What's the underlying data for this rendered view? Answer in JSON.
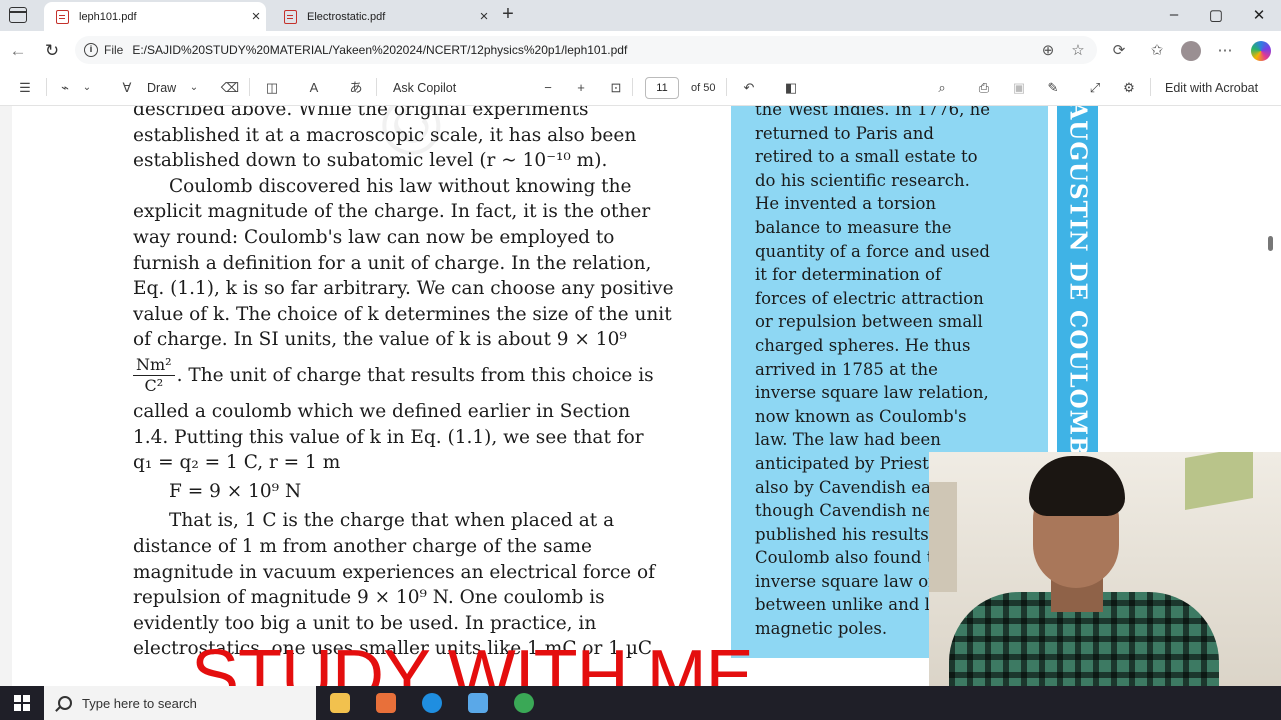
{
  "browser": {
    "tabs": [
      {
        "label": "leph101.pdf",
        "icon": "pdf-icon",
        "active": true
      },
      {
        "label": "Electrostatic.pdf",
        "icon": "pdf-icon",
        "active": false
      }
    ],
    "address": {
      "scheme_label": "File",
      "url": "E:/SAJID%20STUDY%20MATERIAL/Yakeen%202024/NCERT/12physics%20p1/leph101.pdf"
    }
  },
  "pdf_toolbar": {
    "draw_label": "Draw",
    "ask_copilot_label": "Ask Copilot",
    "page_current": "11",
    "page_total": "of 50",
    "edit_acrobat_label": "Edit with Acrobat"
  },
  "document": {
    "main_lines": [
      "described above. While the original experiments",
      "established it at a macroscopic scale, it has also been",
      "established down to subatomic level  (r ~ 10⁻¹⁰ m).",
      "Coulomb discovered his law without knowing the",
      "explicit magnitude of the charge. In fact, it is the other",
      "way round: Coulomb's law can now be employed to",
      "furnish a definition for a unit of charge. In the relation,",
      "Eq. (1.1), k is so far arbitrary. We can choose any positive",
      "value of k. The choice of k determines the size of the unit",
      "of charge. In SI units, the value of k is about 9 × 10⁹",
      ". The unit of charge that results from this choice is",
      "called a coulomb which we defined earlier in Section",
      "1.4. Putting this value of k in Eq. (1.1), we see that for",
      "q₁ = q₂ = 1 C, r = 1 m",
      "F = 9 × 10⁹ N",
      "That is, 1 C is the charge that when placed at a",
      "distance of 1 m from another charge of the same",
      "magnitude in vacuum experiences an electrical force of",
      "repulsion of magnitude 9 × 10⁹ N. One coulomb is",
      "evidently too big a unit to be used. In practice, in",
      "electrostatics, one uses smaller units like 1 mC or 1 µC."
    ],
    "fraction": {
      "numerator": "Nm²",
      "denominator": "C²"
    },
    "side_lines": [
      "the West Indies. In 1776, he",
      "returned to Paris and",
      "retired to a small estate to",
      "do his scientific research.",
      "He invented a torsion",
      "balance to measure the",
      "quantity of a force and used",
      "it for determination of",
      "forces of electric attraction",
      "or repulsion between small",
      "charged spheres. He thus",
      "arrived in 1785 at the",
      "inverse square law relation,",
      "now known as Coulomb's",
      "law. The law had been",
      "anticipated by Priestley and",
      "also by Cavendish earlier,",
      "though Cavendish never",
      "published his results.",
      "Coulomb also found the",
      "inverse square law of force",
      "between unlike and like",
      "magnetic poles."
    ],
    "side_title": "AUGUSTIN DE COULOMB",
    "watermark": "© NCERT not to be republished"
  },
  "overlay": {
    "title": "STUDY WITH ME",
    "color": "#e40e0e"
  },
  "taskbar": {
    "search_placeholder": "Type here to search"
  }
}
